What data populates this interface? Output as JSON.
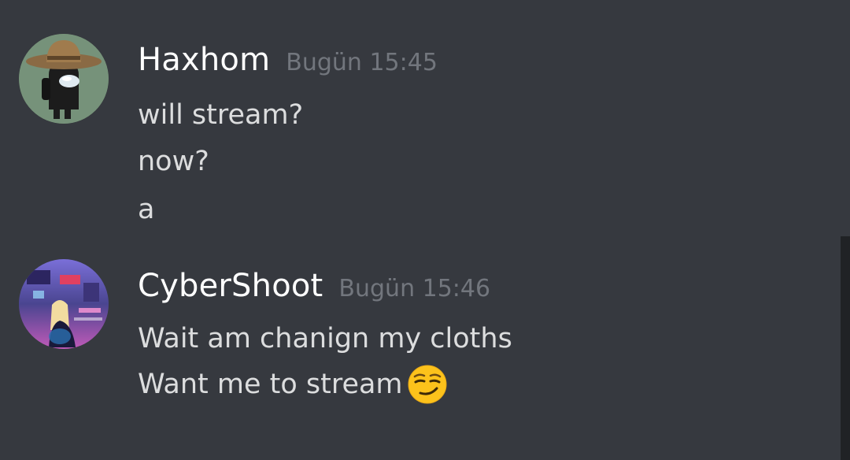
{
  "messages": [
    {
      "username": "Haxhom",
      "timestamp": "Bugün 15:45",
      "avatar_icon": "among-us-cowboy-hat-avatar",
      "lines": [
        "will stream?",
        "now?",
        "a"
      ]
    },
    {
      "username": "CyberShoot",
      "timestamp": "Bugün 15:46",
      "avatar_icon": "cyberpunk-girl-avatar",
      "lines": [
        "Wait am chanign my cloths",
        "Want me to stream"
      ],
      "emoji": "smirk-emoji"
    }
  ],
  "colors": {
    "background": "#36393f",
    "username": "#ffffff",
    "timestamp": "#72767d",
    "message_text": "#dcddde",
    "scrollbar": "#202225"
  }
}
